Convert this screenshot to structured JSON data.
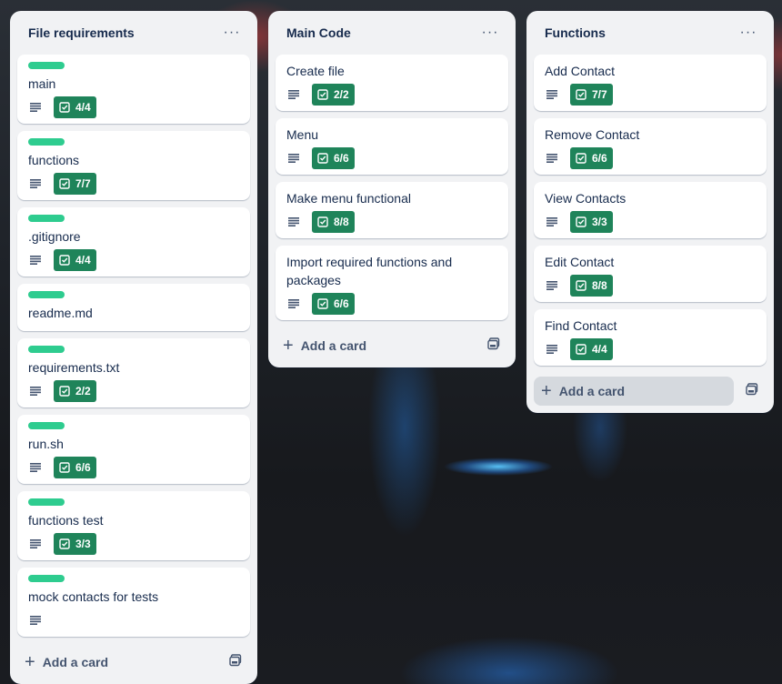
{
  "lists": [
    {
      "title": "File requirements",
      "cards": [
        {
          "title": "main",
          "label": true,
          "checklist": "4/4"
        },
        {
          "title": "functions",
          "label": true,
          "checklist": "7/7"
        },
        {
          "title": ".gitignore",
          "label": true,
          "checklist": "4/4"
        },
        {
          "title": "readme.md",
          "label": true,
          "checklist": null
        },
        {
          "title": "requirements.txt",
          "label": true,
          "checklist": "2/2"
        },
        {
          "title": "run.sh",
          "label": true,
          "checklist": "6/6"
        },
        {
          "title": "functions test",
          "label": true,
          "checklist": "3/3"
        },
        {
          "title": "mock contacts for tests",
          "label": true,
          "checklist": null,
          "description_only": true
        }
      ],
      "add_card_label": "Add a card"
    },
    {
      "title": "Main Code",
      "cards": [
        {
          "title": "Create file",
          "label": false,
          "checklist": "2/2"
        },
        {
          "title": "Menu",
          "label": false,
          "checklist": "6/6"
        },
        {
          "title": "Make menu functional",
          "label": false,
          "checklist": "8/8"
        },
        {
          "title": "Import required functions and packages",
          "label": false,
          "checklist": "6/6"
        }
      ],
      "add_card_label": "Add a card"
    },
    {
      "title": "Functions",
      "cards": [
        {
          "title": "Add Contact",
          "label": false,
          "checklist": "7/7"
        },
        {
          "title": "Remove Contact",
          "label": false,
          "checklist": "6/6"
        },
        {
          "title": "View Contacts",
          "label": false,
          "checklist": "3/3"
        },
        {
          "title": "Edit Contact",
          "label": false,
          "checklist": "8/8"
        },
        {
          "title": "Find Contact",
          "label": false,
          "checklist": "4/4"
        }
      ],
      "add_card_label": "Add a card"
    }
  ],
  "list_menu_glyph": "···",
  "add_card_glyph": "+",
  "icons": {
    "list_menu": "ellipsis-icon",
    "description": "description-lines-icon",
    "checklist": "checkbox-icon",
    "add": "plus-icon",
    "template": "card-template-icon"
  },
  "colors": {
    "label_green": "#2ecc8f",
    "checklist_complete": "#1f845a",
    "list_bg": "#f1f2f4",
    "text": "#172b4d"
  }
}
